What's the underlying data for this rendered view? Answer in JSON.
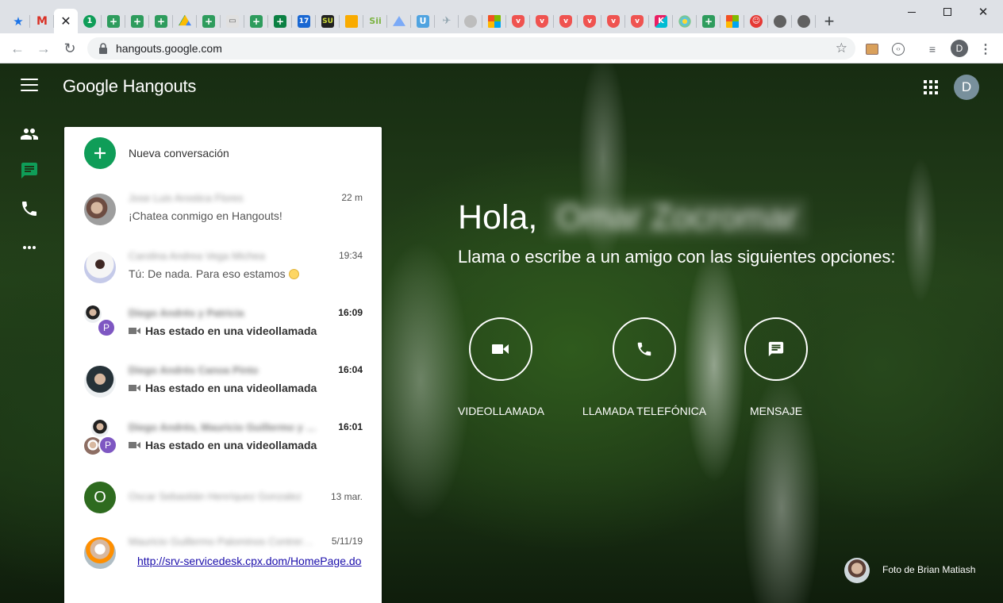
{
  "browser": {
    "tabs": [
      {
        "icon": "bookmark-star-icon",
        "color": "#1a73e8"
      },
      {
        "icon": "gmail-icon",
        "color": "#d93025"
      },
      {
        "icon": "hangouts-close-icon",
        "color": "#202124"
      },
      {
        "icon": "numbered-one-icon",
        "color": "#0f9d58"
      },
      {
        "icon": "sheets-icon",
        "color": "#2e9c5d"
      },
      {
        "icon": "sheets-icon",
        "color": "#2e9c5d"
      },
      {
        "icon": "sheets-icon",
        "color": "#2e9c5d"
      },
      {
        "icon": "drive-icon",
        "color": "#fbbc04"
      },
      {
        "icon": "sheets-icon",
        "color": "#2e9c5d"
      },
      {
        "icon": "book-icon",
        "color": "#9e9e9e"
      },
      {
        "icon": "sheets-icon",
        "color": "#2e9c5d"
      },
      {
        "icon": "sheets-dark-icon",
        "color": "#0b8043"
      },
      {
        "icon": "calendar-icon",
        "color": "#1967d2"
      },
      {
        "icon": "su-icon",
        "color": "#212121"
      },
      {
        "icon": "keep-icon",
        "color": "#f9ab00"
      },
      {
        "icon": "sii-icon",
        "color": "#7cb342"
      },
      {
        "icon": "drive-icon",
        "color": "#7baaf7"
      },
      {
        "icon": "u-icon",
        "color": "#4fa3e0"
      },
      {
        "icon": "plane-icon",
        "color": "#90a4ae"
      },
      {
        "icon": "globe-icon",
        "color": "#9e9e9e"
      },
      {
        "icon": "windows-icon",
        "color": "#f25022"
      },
      {
        "icon": "pocket-icon",
        "color": "#ef5350"
      },
      {
        "icon": "pocket-icon",
        "color": "#ef5350"
      },
      {
        "icon": "pocket-icon",
        "color": "#ef5350"
      },
      {
        "icon": "pocket-icon",
        "color": "#ef5350"
      },
      {
        "icon": "pocket-icon",
        "color": "#ef5350"
      },
      {
        "icon": "pocket-icon",
        "color": "#ef5350"
      },
      {
        "icon": "kahoot-icon",
        "color": "#e91e63"
      },
      {
        "icon": "flower-icon",
        "color": "#4fc3f7"
      },
      {
        "icon": "sheets-icon",
        "color": "#2e9c5d"
      },
      {
        "icon": "windows-icon",
        "color": "#f25022"
      },
      {
        "icon": "smiley-icon",
        "color": "#e53935"
      },
      {
        "icon": "globe-icon",
        "color": "#616161"
      },
      {
        "icon": "globe-icon",
        "color": "#616161"
      }
    ],
    "url": "hangouts.google.com",
    "profile_initial": "D"
  },
  "app": {
    "brand": "Google Hangouts",
    "account_initial": "D"
  },
  "panel": {
    "new_conversation": "Nueva conversación",
    "conversations": [
      {
        "name": "Jose Luis Arostica Flores",
        "time": "22 m",
        "message": "¡Chatea conmigo en Hangouts!",
        "unread": false
      },
      {
        "name": "Carolina Andrea Vega Michea",
        "time": "19:34",
        "message": "Tú: De nada. Para eso estamos",
        "unread": false
      },
      {
        "name": "Diego Andrés y Patricia",
        "time": "16:09",
        "message": "Has estado en una videollamada",
        "unread": true,
        "badge": "P"
      },
      {
        "name": "Diego Andrés Canoa Pinto",
        "time": "16:04",
        "message": "Has estado en una videollamada",
        "unread": true
      },
      {
        "name": "Diego Andrés, Mauricio Guillermo y Pat…",
        "time": "16:01",
        "message": "Has estado en una videollamada",
        "unread": true,
        "badge": "P"
      },
      {
        "name": "Oscar Sebastián Henríquez Gonzalez",
        "time": "13 mar.",
        "message": "",
        "unread": false,
        "initial": "O"
      },
      {
        "name": "Mauricio Guillermo Palominos Contrer…",
        "time": "5/11/19",
        "message": "http://srv-servicedesk.cpx.dom/HomePage.do",
        "unread": false
      }
    ]
  },
  "center": {
    "greeting": "Hola,",
    "user_name": "Omar Zocromar",
    "subtitle": "Llama o escribe a un amigo con las siguientes opciones:",
    "actions": [
      {
        "label": "VIDEOLLAMADA",
        "icon": "videocam-icon"
      },
      {
        "label": "LLAMADA TELEFÓNICA",
        "icon": "phone-icon"
      },
      {
        "label": "MENSAJE",
        "icon": "message-icon"
      }
    ]
  },
  "photo_credit": "Foto de Brian Matiash",
  "colors": {
    "hangouts_green": "#0f9d58",
    "link_blue": "#1a0dab",
    "badge_purple": "#7e57c2",
    "oscar_avatar": "#2e6b1f"
  }
}
